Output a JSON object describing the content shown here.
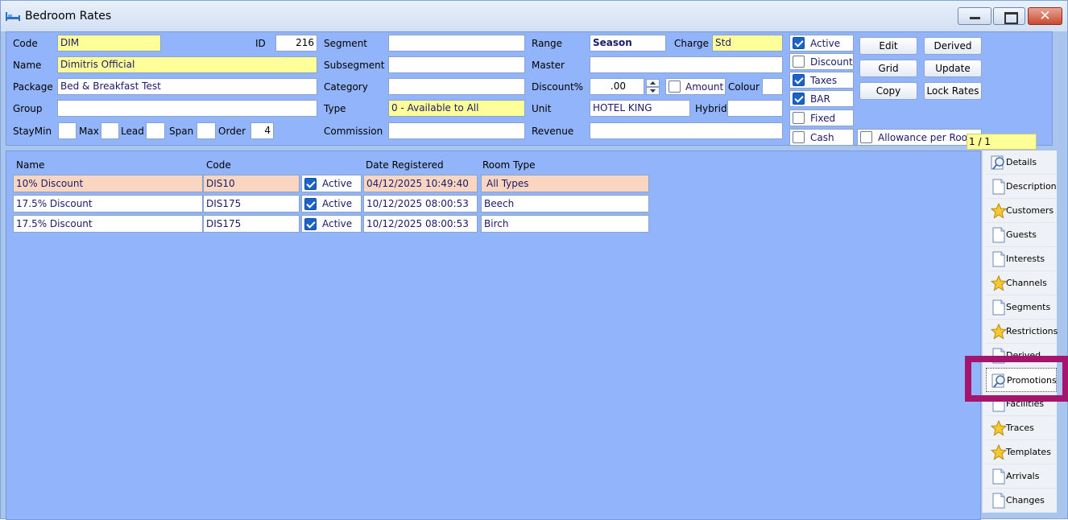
{
  "window": {
    "title": "Bedroom Rates",
    "close_glyph": "✕"
  },
  "colors": {
    "panel_blue": "#92b4fb",
    "field_yellow": "#ffff99",
    "row_highlight": "#fad6c0",
    "frame_magenta": "#a5156d"
  },
  "form": {
    "code_label": "Code",
    "code_value": "DIM",
    "id_label": "ID",
    "id_value": "216",
    "name_label": "Name",
    "name_value": "Dimitris Official",
    "package_label": "Package",
    "package_value": "Bed & Breakfast Test",
    "group_label": "Group",
    "group_value": "",
    "staymin_label": "StayMin",
    "staymin_value": "",
    "max_label": "Max",
    "max_value": "",
    "lead_label": "Lead",
    "lead_value": "",
    "span_label": "Span",
    "span_value": "",
    "order_label": "Order",
    "order_value": "4",
    "segment_label": "Segment",
    "segment_value": "",
    "subsegment_label": "Subsegment",
    "subsegment_value": "",
    "category_label": "Category",
    "category_value": "",
    "type_label": "Type",
    "type_value": "0 - Available to All",
    "commission_label": "Commission",
    "commission_value": "",
    "range_label": "Range",
    "range_value": "Season",
    "charge_label": "Charge",
    "charge_value": "Std",
    "master_label": "Master",
    "master_value": "",
    "discount_pct_label": "Discount%",
    "discount_pct_value": ".00",
    "amount_label": "Amount",
    "colour_label": "Colour",
    "colour_value": "",
    "unit_label": "Unit",
    "unit_value": "HOTEL KING",
    "hybrid_label": "Hybrid",
    "hybrid_value": "",
    "revenue_label": "Revenue",
    "revenue_value": ""
  },
  "flags": {
    "active_label": "Active",
    "discount_label": "Discount",
    "taxes_label": "Taxes",
    "bar_label": "BAR",
    "fixed_label": "Fixed",
    "cash_label": "Cash",
    "allowance_label": "Allowance per Room"
  },
  "buttons": {
    "edit": "Edit",
    "derived": "Derived",
    "grid": "Grid",
    "update": "Update",
    "copy": "Copy",
    "lock_rates": "Lock Rates"
  },
  "pager": "1 / 1",
  "grid": {
    "headers": {
      "name": "Name",
      "code": "Code",
      "date": "Date Registered",
      "room_type": "Room Type"
    },
    "rows": [
      {
        "name": "10% Discount",
        "code": "DIS10",
        "active_label": "Active",
        "date": "04/12/2025 10:49:40",
        "room_type": "All Types",
        "highlight": true
      },
      {
        "name": "17.5% Discount",
        "code": "DIS175",
        "active_label": "Active",
        "date": "10/12/2025 08:00:53",
        "room_type": "Beech",
        "highlight": false
      },
      {
        "name": "17.5% Discount",
        "code": "DIS175",
        "active_label": "Active",
        "date": "10/12/2025 08:00:53",
        "room_type": "Birch",
        "highlight": false
      }
    ]
  },
  "sidebar": {
    "items": [
      {
        "label": "Details",
        "icon": "magnifier-doc-icon"
      },
      {
        "label": "Description",
        "icon": "document-icon"
      },
      {
        "label": "Customers",
        "icon": "star-icon"
      },
      {
        "label": "Guests",
        "icon": "document-icon"
      },
      {
        "label": "Interests",
        "icon": "document-icon"
      },
      {
        "label": "Channels",
        "icon": "star-icon"
      },
      {
        "label": "Segments",
        "icon": "document-icon"
      },
      {
        "label": "Restrictions",
        "icon": "star-icon"
      },
      {
        "label": "Derived",
        "icon": "document-icon"
      },
      {
        "label": "Promotions",
        "icon": "magnifier-doc-icon"
      },
      {
        "label": "Facilities",
        "icon": "document-icon"
      },
      {
        "label": "Traces",
        "icon": "star-icon"
      },
      {
        "label": "Templates",
        "icon": "star-icon"
      },
      {
        "label": "Arrivals",
        "icon": "document-icon"
      },
      {
        "label": "Changes",
        "icon": "document-icon"
      }
    ]
  }
}
